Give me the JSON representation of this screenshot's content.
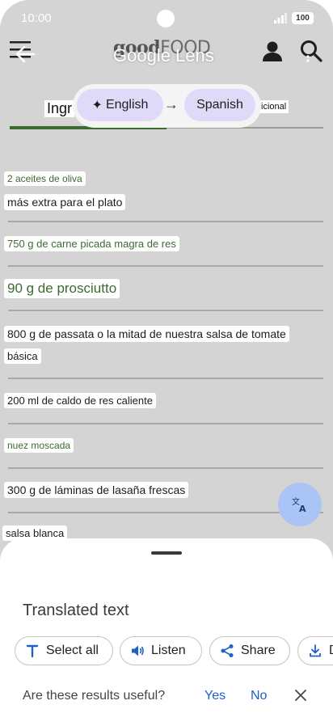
{
  "status": {
    "time": "10:00",
    "battery": "100"
  },
  "header": {
    "logo_good": "good",
    "logo_food": "FOOD",
    "lens_title": "Google Lens"
  },
  "tabs": {
    "ingredients_partial": "Ingr",
    "info_partial": "icional"
  },
  "language": {
    "source": "English",
    "arrow": "→",
    "target": "Spanish"
  },
  "ingredients": [
    "2 aceites de oliva",
    "más extra para el plato",
    "750 g de carne picada magra de res",
    "90 g de prosciutto",
    "800 g de passata o la mitad de nuestra salsa de tomate",
    "básica",
    "200 ml de caldo de res caliente",
    "nuez moscada",
    "300 g de láminas de lasaña frescas",
    "salsa blanca"
  ],
  "sheet": {
    "title": "Translated text",
    "actions": {
      "select_all": "Select all",
      "listen": "Listen",
      "share": "Share",
      "download_partial": "D"
    },
    "feedback": {
      "question": "Are these results useful?",
      "yes": "Yes",
      "no": "No"
    }
  },
  "colors": {
    "accent_green": "#3b6b2f",
    "chip_purple": "#e0d9f8",
    "fab_blue": "#a9c4f5",
    "link_blue": "#1a62c6"
  }
}
